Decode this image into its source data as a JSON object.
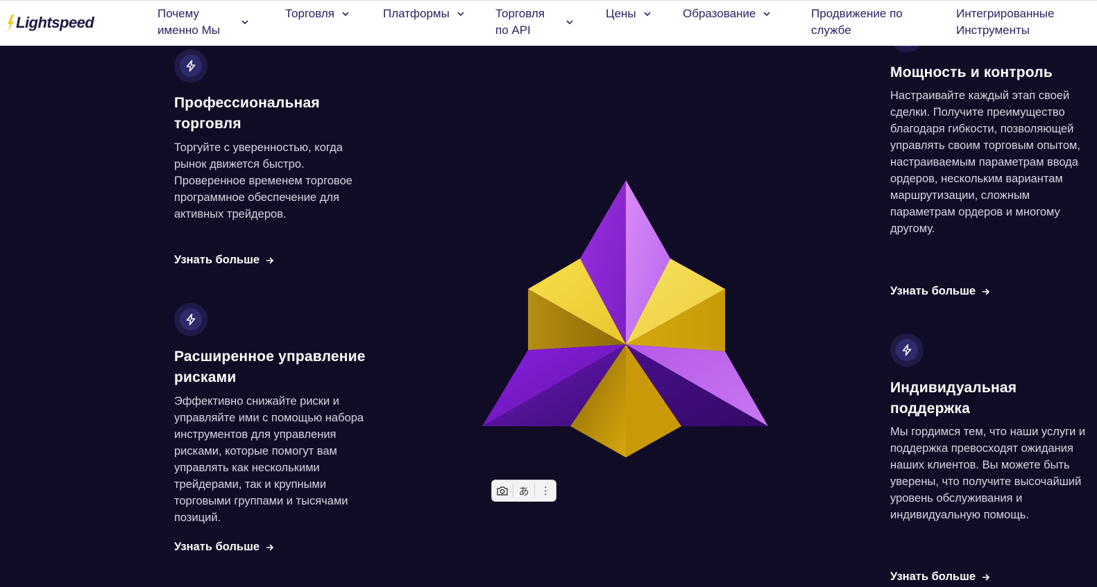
{
  "logo": {
    "text": "Lightspeed"
  },
  "nav": {
    "items": [
      {
        "label": "Почему\nименно Мы",
        "has_dropdown": true
      },
      {
        "label": "Торговля",
        "has_dropdown": true
      },
      {
        "label": "Платформы",
        "has_dropdown": true
      },
      {
        "label": "Торговля\nпо API",
        "has_dropdown": true
      },
      {
        "label": "Цены",
        "has_dropdown": true
      },
      {
        "label": "Образование",
        "has_dropdown": true
      },
      {
        "label": "Продвижение по\nслужбе",
        "has_dropdown": false
      },
      {
        "label": "Интегрированные\nИнструменты",
        "has_dropdown": false
      }
    ]
  },
  "features": {
    "pro_trading": {
      "icon": "lightning-icon",
      "title": "Профессиональная торговля",
      "text": "Торгуйте с уверенностью, когда рынок движется быстро. Проверенное временем торговое программное обеспечение для активных трейдеров.",
      "link": "Узнать больше"
    },
    "risk_management": {
      "icon": "lightning-icon",
      "title": "Расширенное управление рисками",
      "text": "Эффективно снижайте риски и управляйте ими с помощью набора инструментов для управления рисками, которые помогут вам управлять как несколькими трейдерами, так и крупными торговыми группами и тысячами позиций.",
      "link": "Узнать больше"
    },
    "power_control": {
      "icon": "lightning-icon",
      "title": "Мощность и контроль",
      "text": "Настраивайте каждый этап своей сделки. Получите преимущество благодаря гибкости, позволяющей управлять своим торговым опытом, настраиваемым параметрам ввода ордеров, нескольким вариантам маршрутизации, сложным параметрам ордеров и многому другому.",
      "link": "Узнать больше"
    },
    "support": {
      "icon": "lightning-icon",
      "title": "Индивидуальная поддержка",
      "text": "Мы гордимся тем, что наши услуги и поддержка превосходят ожидания наших клиентов. Вы можете быть уверены, что получите высочайший уровень обслуживания и индивидуальную помощь.",
      "link": "Узнать больше"
    }
  },
  "translate_toolbar": {
    "lens_icon": "camera-search-icon",
    "translate_glyph": "あ",
    "more_glyph": "⋮"
  },
  "colors": {
    "background": "#110c26",
    "nav_text": "#2a2260",
    "accent_purple": "#a64be6",
    "accent_yellow": "#e8c62e"
  }
}
